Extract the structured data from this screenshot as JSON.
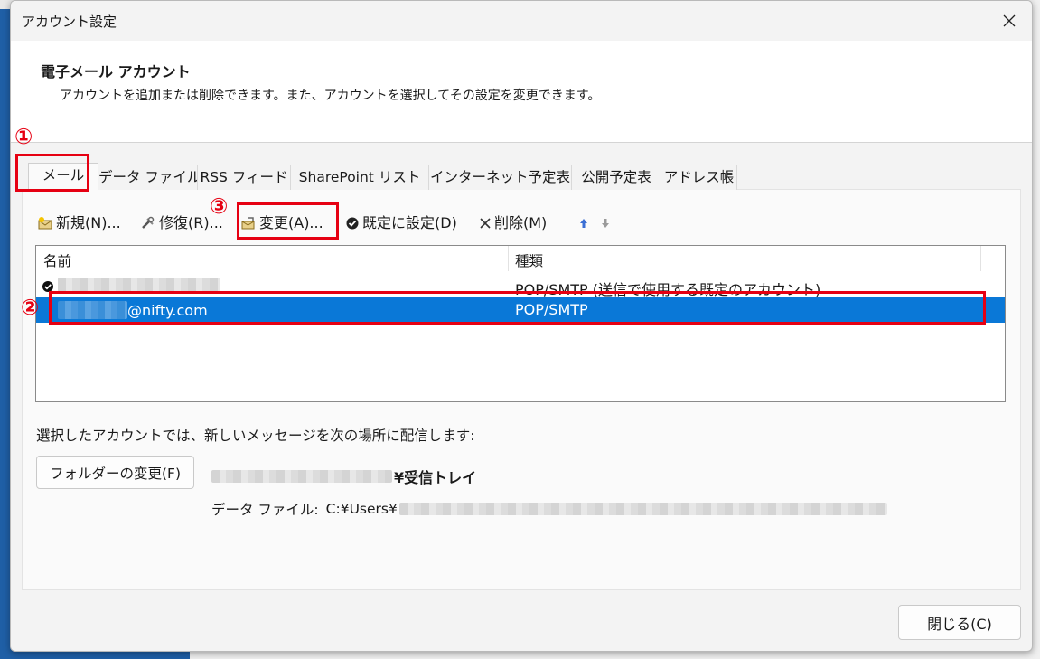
{
  "window": {
    "title": "アカウント設定"
  },
  "header": {
    "title": "電子メール アカウント",
    "description": "アカウントを追加または削除できます。また、アカウントを選択してその設定を変更できます。"
  },
  "tabs": [
    {
      "label": "メール",
      "active": true
    },
    {
      "label": "データ ファイル"
    },
    {
      "label": "RSS フィード"
    },
    {
      "label": "SharePoint リスト"
    },
    {
      "label": "インターネット予定表"
    },
    {
      "label": "公開予定表"
    },
    {
      "label": "アドレス帳"
    }
  ],
  "toolbar": {
    "new_label": "新規(N)...",
    "repair_label": "修復(R)...",
    "change_label": "変更(A)...",
    "set_default_label": "既定に設定(D)",
    "delete_label": "削除(M)"
  },
  "accounts": {
    "columns": {
      "name": "名前",
      "type": "種類"
    },
    "rows": [
      {
        "name_suffix": "",
        "type": "POP/SMTP (送信で使用する既定のアカウント)",
        "is_default": true
      },
      {
        "name_suffix": "@nifty.com",
        "type": "POP/SMTP",
        "selected": true
      }
    ]
  },
  "delivery": {
    "label": "選択したアカウントでは、新しいメッセージを次の場所に配信します:",
    "folder_button": "フォルダーの変更(F)",
    "inbox_suffix": "¥受信トレイ",
    "data_file_label": "データ ファイル:",
    "data_file_path": "C:¥Users¥"
  },
  "footer": {
    "close_button": "閉じる(C)"
  },
  "annotations": [
    "①",
    "②",
    "③"
  ],
  "colors": {
    "selection": "#0a78d7",
    "highlight": "#e60012"
  }
}
